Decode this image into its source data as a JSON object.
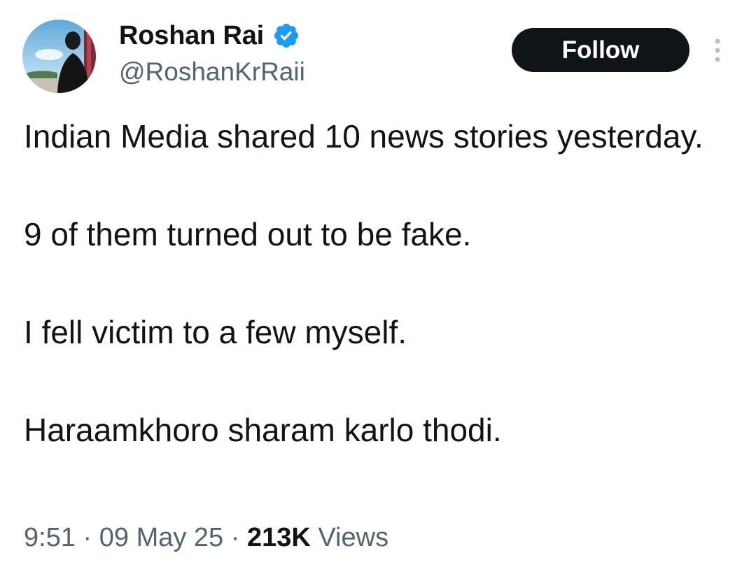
{
  "author": {
    "display_name": "Roshan Rai",
    "handle": "@RoshanKrRaii",
    "verified": true,
    "avatar": "profile-photo"
  },
  "actions": {
    "follow_label": "Follow",
    "more_icon": "more-vertical-icon"
  },
  "tweet": {
    "paragraphs": [
      "Indian Media shared 10 news stories yesterday.",
      "9 of them turned out to be fake.",
      "I fell victim to a few myself.",
      "Haraamkhoro sharam karlo thodi."
    ]
  },
  "meta": {
    "time": "9:51",
    "separator": " · ",
    "date": "09 May 25",
    "views_count": "213K",
    "views_label": " Views"
  },
  "colors": {
    "text_primary": "#0f1419",
    "text_secondary": "#536471",
    "verified_blue": "#1d9bf0",
    "button_bg": "#0f1419",
    "button_text": "#ffffff"
  }
}
